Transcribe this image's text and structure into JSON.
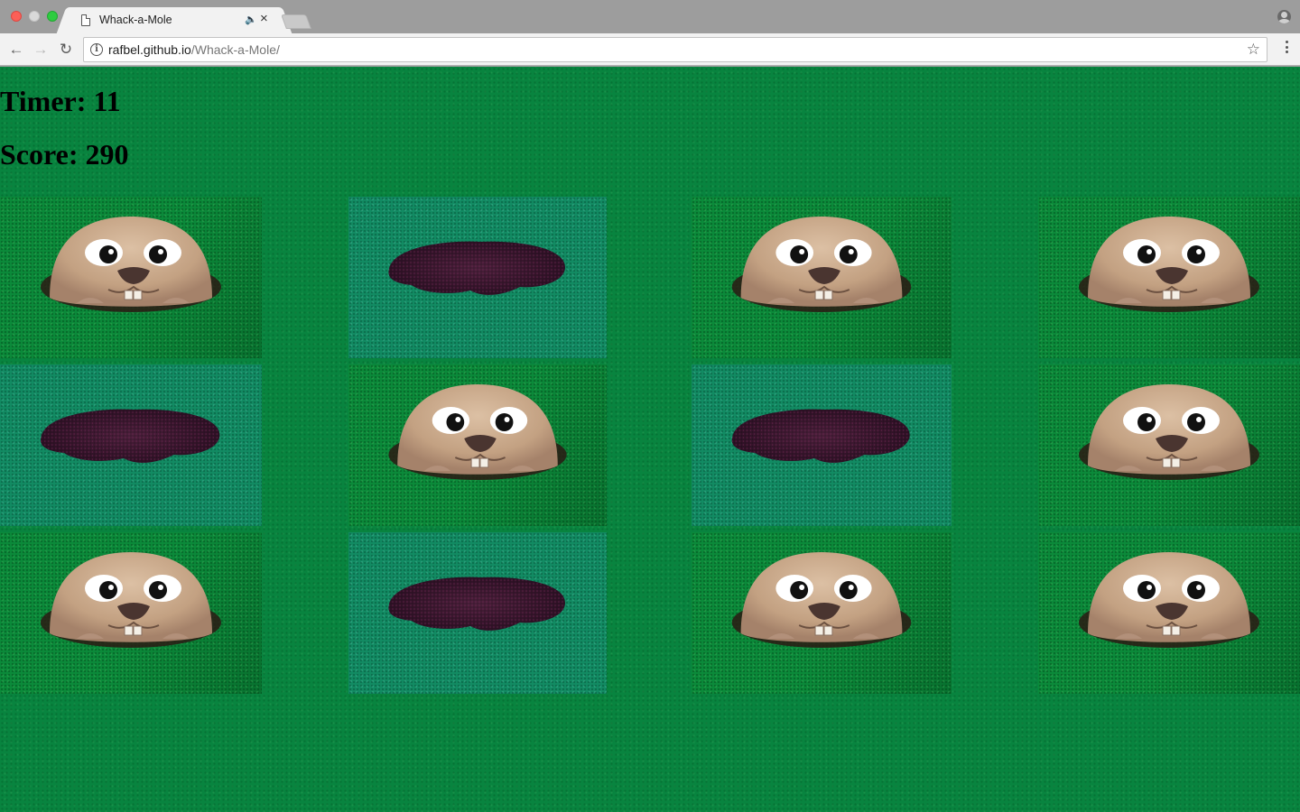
{
  "browser": {
    "tab_title": "Whack-a-Mole",
    "url_host": "rafbel.github.io",
    "url_path": "/Whack-a-Mole/"
  },
  "game": {
    "timer_label": "Timer: 11",
    "score_label": "Score: 290",
    "timer": 11,
    "score": 290,
    "grid": [
      [
        "mole",
        "hole",
        "mole",
        "mole"
      ],
      [
        "hole",
        "mole",
        "hole",
        "mole"
      ],
      [
        "mole",
        "hole",
        "mole",
        "mole"
      ]
    ]
  },
  "colors": {
    "background_grass": "#08843f",
    "mole_fur": "#c9a98c",
    "hole_dark": "#3a1a2c"
  }
}
